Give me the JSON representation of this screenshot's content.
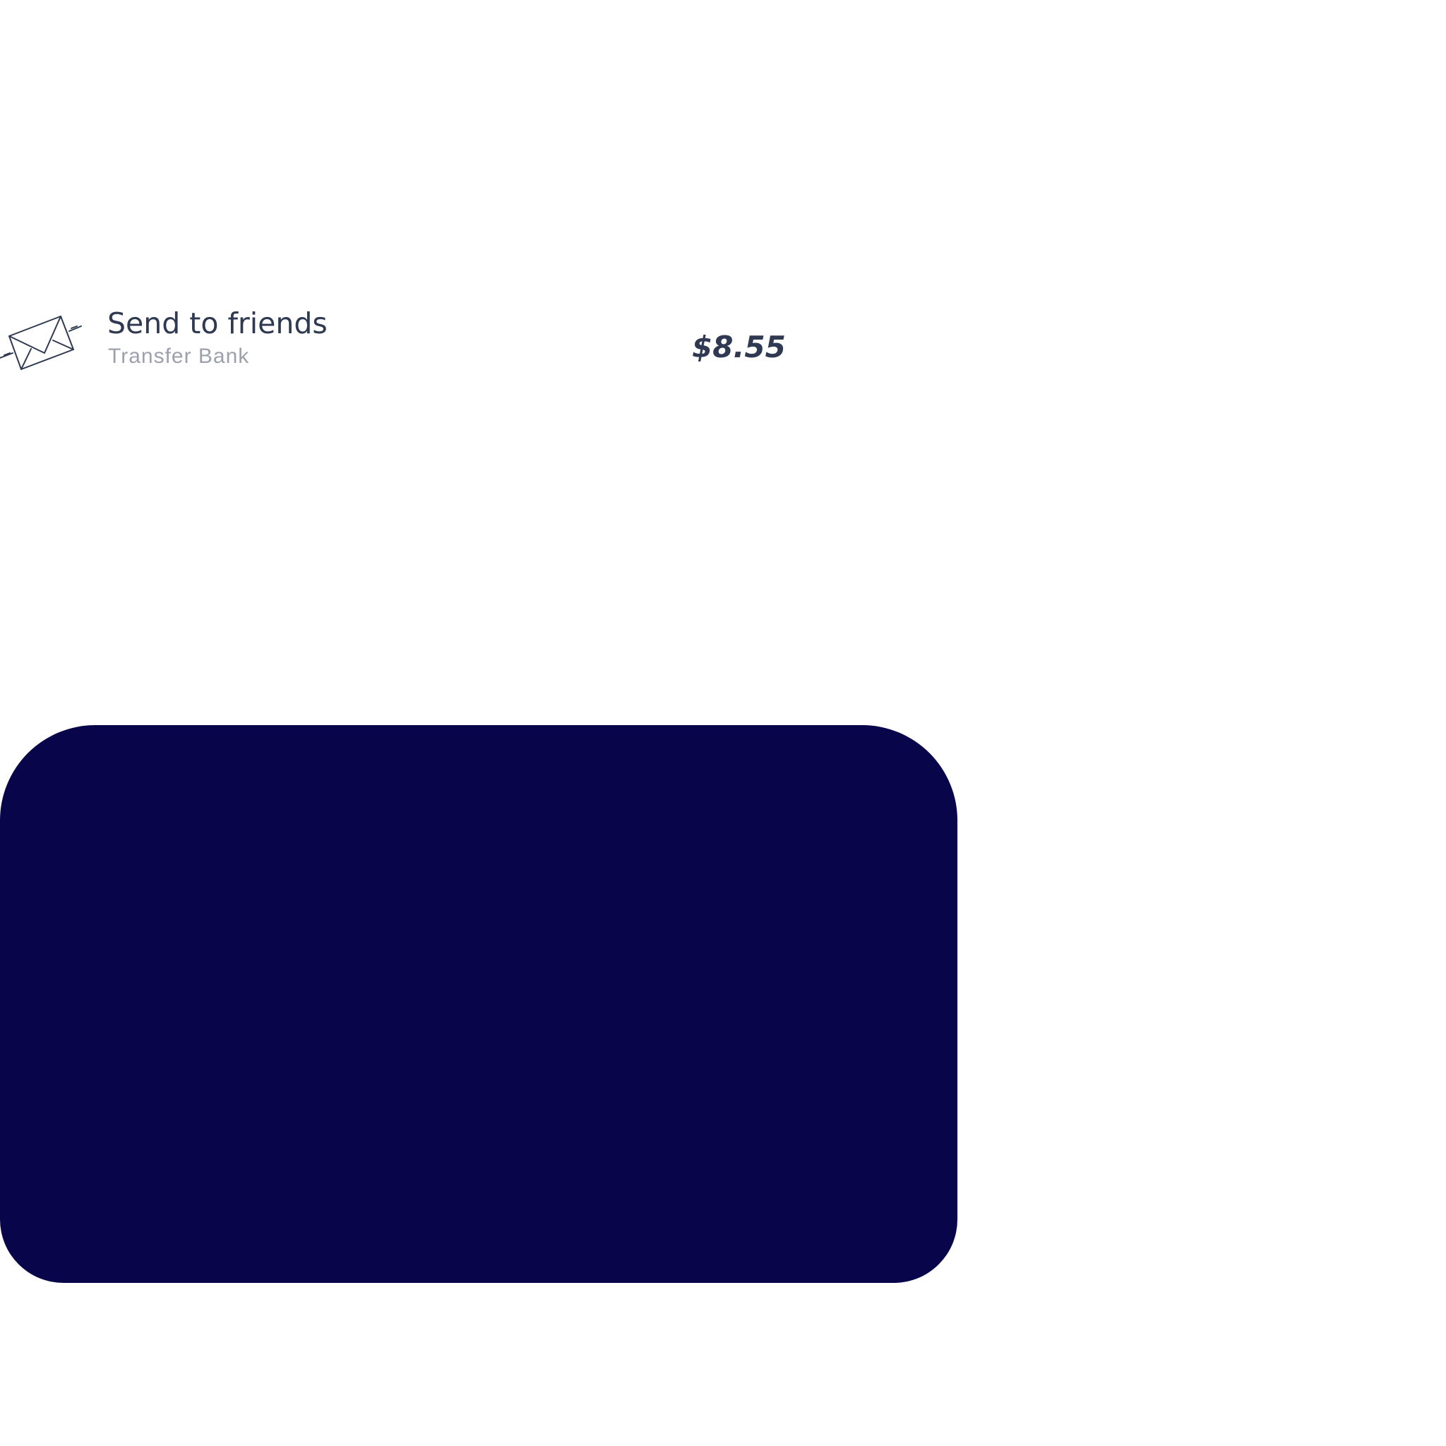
{
  "transaction": {
    "icon": "mail-send-icon",
    "title": "Send to friends",
    "subtitle": "Transfer Bank",
    "amount": "$8.55"
  },
  "card": {
    "color": "#08054a"
  },
  "colors": {
    "text_primary": "#2f3a52",
    "text_secondary": "#9ea1ad",
    "background": "#ffffff"
  }
}
